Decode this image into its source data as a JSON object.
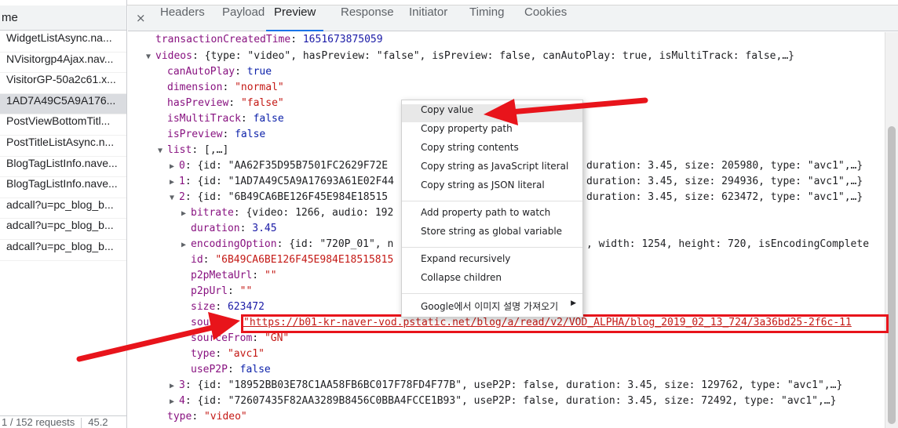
{
  "left": {
    "column_header": "me",
    "requests": [
      {
        "name": "WidgetListAsync.na...",
        "selected": false
      },
      {
        "name": "NVisitorgp4Ajax.nav...",
        "selected": false
      },
      {
        "name": "VisitorGP-50a2c61.x...",
        "selected": false
      },
      {
        "name": "1AD7A49C5A9A176...",
        "selected": true
      },
      {
        "name": "PostViewBottomTitl...",
        "selected": false
      },
      {
        "name": "PostTitleListAsync.n...",
        "selected": false
      },
      {
        "name": "BlogTagListInfo.nave...",
        "selected": false
      },
      {
        "name": "BlogTagListInfo.nave...",
        "selected": false
      },
      {
        "name": "adcall?u=pc_blog_b...",
        "selected": false
      },
      {
        "name": "adcall?u=pc_blog_b...",
        "selected": false
      },
      {
        "name": "adcall?u=pc_blog_b...",
        "selected": false
      }
    ],
    "status_requests": "1 / 152 requests",
    "status_size": "45.2"
  },
  "tabs": {
    "close": "×",
    "items": [
      {
        "label": "Headers",
        "active": false
      },
      {
        "label": "Payload",
        "active": false
      },
      {
        "label": "Preview",
        "active": true
      },
      {
        "label": "Response",
        "active": false
      },
      {
        "label": "Initiator",
        "active": false
      },
      {
        "label": "Timing",
        "active": false
      },
      {
        "label": "Cookies",
        "active": false
      }
    ]
  },
  "preview": {
    "l_transaction": {
      "key": "transactionCreatedTime",
      "value": "1651673875059"
    },
    "l_videos": {
      "key": "videos",
      "summary": "{type: \"video\", hasPreview: \"false\", isPreview: false, canAutoPlay: true, isMultiTrack: false,…}"
    },
    "l_canAutoPlay": {
      "key": "canAutoPlay",
      "value": "true"
    },
    "l_dimension": {
      "key": "dimension",
      "value": "\"normal\""
    },
    "l_hasPreview": {
      "key": "hasPreview",
      "value": "\"false\""
    },
    "l_isMultiTrack": {
      "key": "isMultiTrack",
      "value": "false"
    },
    "l_isPreview": {
      "key": "isPreview",
      "value": "false"
    },
    "l_list": {
      "key": "list",
      "summary": "[,…]"
    },
    "l_item0": {
      "key": "0",
      "left": "{id: \"AA62F35D95B7501FC2629F72E",
      "right": "duration: 3.45, size: 205980, type: \"avc1\",…}"
    },
    "l_item1": {
      "key": "1",
      "left": "{id: \"1AD7A49C5A9A17693A61E02F44",
      "right": "duration: 3.45, size: 294936, type: \"avc1\",…}"
    },
    "l_item2": {
      "key": "2",
      "left": "{id: \"6B49CA6BE126F45E984E18515",
      "right": "duration: 3.45, size: 623472, type: \"avc1\",…}"
    },
    "l_bitrate": {
      "key": "bitrate",
      "summary": "{video: 1266, audio: 192"
    },
    "l_duration": {
      "key": "duration",
      "value": "3.45"
    },
    "l_encoding": {
      "key": "encodingOption",
      "left": "{id: \"720P_01\", n",
      "right": ", width: 1254, height: 720, isEncodingComplete"
    },
    "l_id": {
      "key": "id",
      "value": "\"6B49CA6BE126F45E984E18515815"
    },
    "l_p2pMetaUrl": {
      "key": "p2pMetaUrl",
      "value": "\"\""
    },
    "l_p2pUrl": {
      "key": "p2pUrl",
      "value": "\"\""
    },
    "l_size": {
      "key": "size",
      "value": "623472"
    },
    "l_source": {
      "key": "source",
      "value": "\"https://b01-kr-naver-vod.pstatic.net/blog/a/read/v2/VOD_ALPHA/blog_2019_02_13_724/3a36bd25-2f6c-11"
    },
    "l_sourceFrom": {
      "key": "sourceFrom",
      "value": "\"GN\""
    },
    "l_type_item": {
      "key": "type",
      "value": "\"avc1\""
    },
    "l_useP2P": {
      "key": "useP2P",
      "value": "false"
    },
    "l_item3": {
      "key": "3",
      "summary": "{id: \"18952BB03E78C1AA58FB6BC017F78FD4F77B\", useP2P: false, duration: 3.45, size: 129762, type: \"avc1\",…}"
    },
    "l_item4": {
      "key": "4",
      "summary": "{id: \"72607435F82AA3289B8456C0BBA4FCCE1B93\", useP2P: false, duration: 3.45, size: 72492, type: \"avc1\",…}"
    },
    "l_type_video": {
      "key": "type",
      "value": "\"video\""
    }
  },
  "context_menu": {
    "copy_value": "Copy value",
    "copy_property_path": "Copy property path",
    "copy_string_contents": "Copy string contents",
    "copy_js_literal": "Copy string as JavaScript literal",
    "copy_json_literal": "Copy string as JSON literal",
    "add_watch": "Add property path to watch",
    "store_global": "Store string as global variable",
    "expand_recursively": "Expand recursively",
    "collapse_children": "Collapse children",
    "google_search": "Google에서 이미지 설명 가져오기"
  },
  "colors": {
    "key": "#881280",
    "string": "#c41a16",
    "number": "#1a1aa6",
    "annotation_red": "#e8141b",
    "active_tab": "#1a73e8"
  }
}
